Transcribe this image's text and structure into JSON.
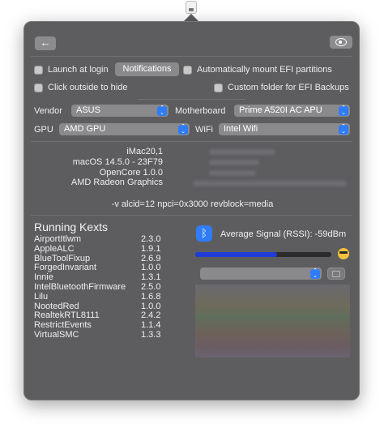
{
  "toolbar": {
    "back_icon": "arrow-left-icon",
    "back_glyph": "←",
    "eye_icon": "eye-icon"
  },
  "options": {
    "launch_at_login": {
      "label": "Launch at login",
      "checked": false
    },
    "notifications_label": "Notifications",
    "auto_mount_efi": {
      "label": "Automatically mount EFI partitions",
      "checked": false
    },
    "click_outside_hide": {
      "label": "Click outside to hide",
      "checked": false
    },
    "custom_efi_folder": {
      "label": "Custom folder for EFI Backups",
      "checked": false
    }
  },
  "hardware": {
    "vendor_label": "Vendor",
    "vendor_value": "ASUS",
    "motherboard_label": "Motherboard",
    "motherboard_value": "Prime A520I AC APU",
    "gpu_label": "GPU",
    "gpu_value": "AMD GPU",
    "wifi_label": "WiFi",
    "wifi_value": "Intel Wifi"
  },
  "system_info": {
    "model": "iMac20,1",
    "macos": "macOS 14.5.0 - 23F79",
    "opencore": "OpenCore 1.0.0",
    "graphics": "AMD Radeon Graphics",
    "boot_args": "-v alcid=12 npci=0x3000 revblock=media"
  },
  "kexts": {
    "title": "Running Kexts",
    "items": [
      {
        "name": "AirportItlwm",
        "version": "2.3.0"
      },
      {
        "name": "AppleALC",
        "version": "1.9.1"
      },
      {
        "name": "BlueToolFixup",
        "version": "2.6.9"
      },
      {
        "name": "ForgedInvariant",
        "version": "1.0.0"
      },
      {
        "name": "Innie",
        "version": "1.3.1"
      },
      {
        "name": "IntelBluetoothFirmware",
        "version": "2.5.0"
      },
      {
        "name": "Lilu",
        "version": "1.6.8"
      },
      {
        "name": "NootedRed",
        "version": "1.0.0"
      },
      {
        "name": "RealtekRTL8111",
        "version": "2.4.2"
      },
      {
        "name": "RestrictEvents",
        "version": "1.1.4"
      },
      {
        "name": "VirtualSMC",
        "version": "1.3.3"
      }
    ]
  },
  "wireless": {
    "bluetooth_icon": "bluetooth-icon",
    "signal_label": "Average Signal (RSSI):",
    "signal_value": "-59dBm",
    "signal_level_percent": 60,
    "signal_emoji": "sunglasses-emoji-icon",
    "accent_color": "#2f7cf6",
    "signal_bar_color": "#1f3bd8"
  }
}
